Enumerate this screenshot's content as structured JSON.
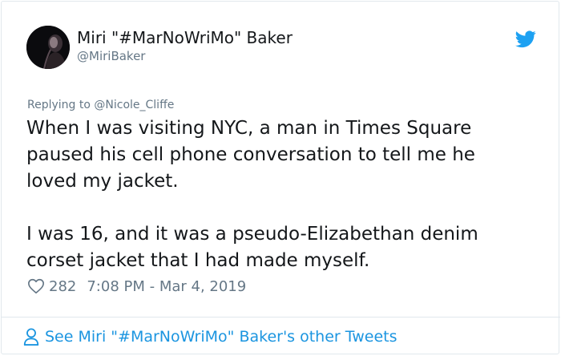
{
  "author": {
    "display_name": "Miri \"#MarNoWriMo\" Baker",
    "handle": "@MiriBaker"
  },
  "reply_context": {
    "prefix": "Replying to ",
    "target_handle": "@Nicole_Cliffe"
  },
  "tweet": {
    "lines_paragraph_1": [
      "When I was visiting NYC, a man in Times Square",
      "paused his cell phone conversation to tell me he",
      "loved my jacket."
    ],
    "lines_paragraph_2": [
      "I was 16, and it was a pseudo-Elizabethan denim",
      "corset jacket that I had made myself."
    ]
  },
  "meta": {
    "like_count": "282",
    "timestamp": "7:08 PM - Mar 4, 2019"
  },
  "footer": {
    "link_text": "See Miri \"#MarNoWriMo\" Baker's other Tweets"
  },
  "icons": {
    "brand": "twitter-bird-icon",
    "like": "heart-icon",
    "profile": "person-icon"
  },
  "colors": {
    "brand_blue": "#1da1f2",
    "link_blue": "#1b95e0",
    "secondary_text": "#657786",
    "primary_text": "#14171a",
    "border": "#e1e8ed"
  }
}
